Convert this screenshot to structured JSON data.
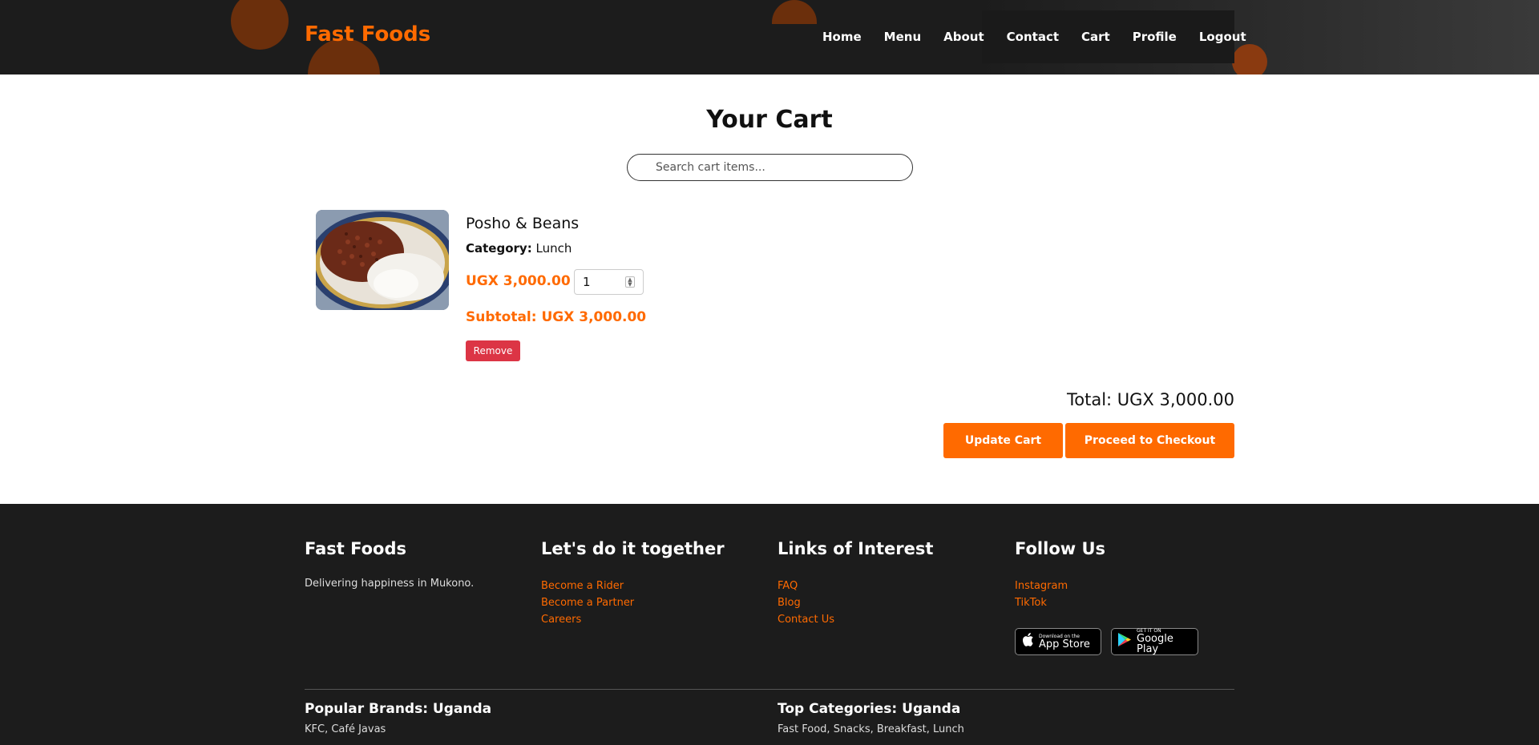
{
  "header": {
    "brand": "Fast Foods",
    "nav": [
      "Home",
      "Menu",
      "About",
      "Contact",
      "Cart",
      "Profile",
      "Logout"
    ]
  },
  "cart": {
    "title": "Your Cart",
    "search_placeholder": "Search cart items...",
    "items": [
      {
        "name": "Posho & Beans",
        "category_label": "Category:",
        "category": "Lunch",
        "price": "UGX 3,000.00 x",
        "quantity": "1",
        "subtotal": "Subtotal: UGX 3,000.00",
        "remove_label": "Remove"
      }
    ],
    "total": "Total: UGX 3,000.00",
    "update_label": "Update Cart",
    "checkout_label": "Proceed to Checkout"
  },
  "footer": {
    "col1": {
      "title": "Fast Foods",
      "text": "Delivering happiness in Mukono."
    },
    "col2": {
      "title": "Let's do it together",
      "links": [
        "Become a Rider",
        "Become a Partner",
        "Careers"
      ]
    },
    "col3": {
      "title": "Links of Interest",
      "links": [
        "FAQ",
        "Blog",
        "Contact Us"
      ]
    },
    "col4": {
      "title": "Follow Us",
      "links": [
        "Instagram",
        "TikTok"
      ],
      "appstore_small": "Download on the",
      "appstore": "App Store",
      "googleplay_small": "GET IT ON",
      "googleplay": "Google Play"
    },
    "brands": {
      "title": "Popular Brands: Uganda",
      "text": "KFC, Café Javas"
    },
    "categories": {
      "title": "Top Categories: Uganda",
      "text": "Fast Food, Snacks, Breakfast, Lunch"
    }
  },
  "colors": {
    "accent": "#ff6a00",
    "danger": "#dc3545",
    "dark": "#1c1c1c"
  }
}
